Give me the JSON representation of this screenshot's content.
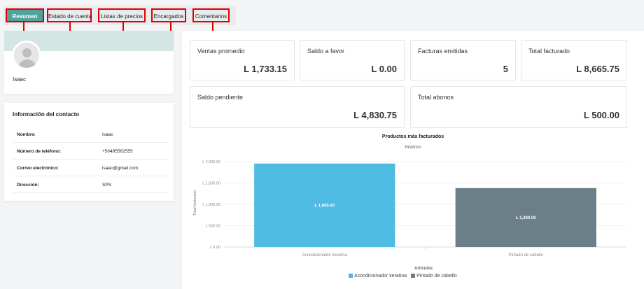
{
  "tabs": [
    {
      "label": "Resumen",
      "annotation": "1"
    },
    {
      "label": "Estado de cuenta",
      "annotation": "2"
    },
    {
      "label": "Listas de precios",
      "annotation": "3"
    },
    {
      "label": "Encargados",
      "annotation": "4"
    },
    {
      "label": "Comentarios",
      "annotation": "5"
    }
  ],
  "profile": {
    "name": "Isaac"
  },
  "contact": {
    "title": "Información del contacto",
    "rows": [
      {
        "label": "Nombre:",
        "value": "Isaac"
      },
      {
        "label": "Número de teléfono:",
        "value": "+50495562555"
      },
      {
        "label": "Correo electrónico:",
        "value": "isaac@gmail.com"
      },
      {
        "label": "Dirección:",
        "value": "SPS"
      }
    ]
  },
  "stats": [
    {
      "label": "Ventas promedio",
      "value": "L 1,733.15"
    },
    {
      "label": "Saldo a favor",
      "value": "L 0.00"
    },
    {
      "label": "Facturas emitidas",
      "value": "5"
    },
    {
      "label": "Total facturado",
      "value": "L 8,665.75"
    },
    {
      "label": "Saldo pendiente",
      "value": "L 4,830.75"
    },
    {
      "label": "Total abonos",
      "value": "L 500.00"
    }
  ],
  "chart_data": {
    "type": "bar",
    "title": "Productos más facturados",
    "subtitle": "Histórico",
    "xlabel": "Artículos",
    "ylabel": "Total facturado",
    "categories": [
      "Acondicionador keratina",
      "Pintado de cabello"
    ],
    "values": [
      1955,
      1380
    ],
    "data_labels": [
      "L 1,955.00",
      "L 1,380.00"
    ],
    "colors": [
      "#4ebbe3",
      "#6b7f89"
    ],
    "ylim": [
      0,
      2000
    ],
    "yticks": [
      0,
      500,
      1000,
      1500,
      2000
    ],
    "ytick_labels": [
      "L 0.00",
      "L 500.00",
      "L 1,000.00",
      "L 1,500.00",
      "L 2,000.00"
    ],
    "legend": [
      "Acondicionador keratina",
      "Pintado de cabello"
    ],
    "legend_position": "bottom",
    "grid": true
  }
}
